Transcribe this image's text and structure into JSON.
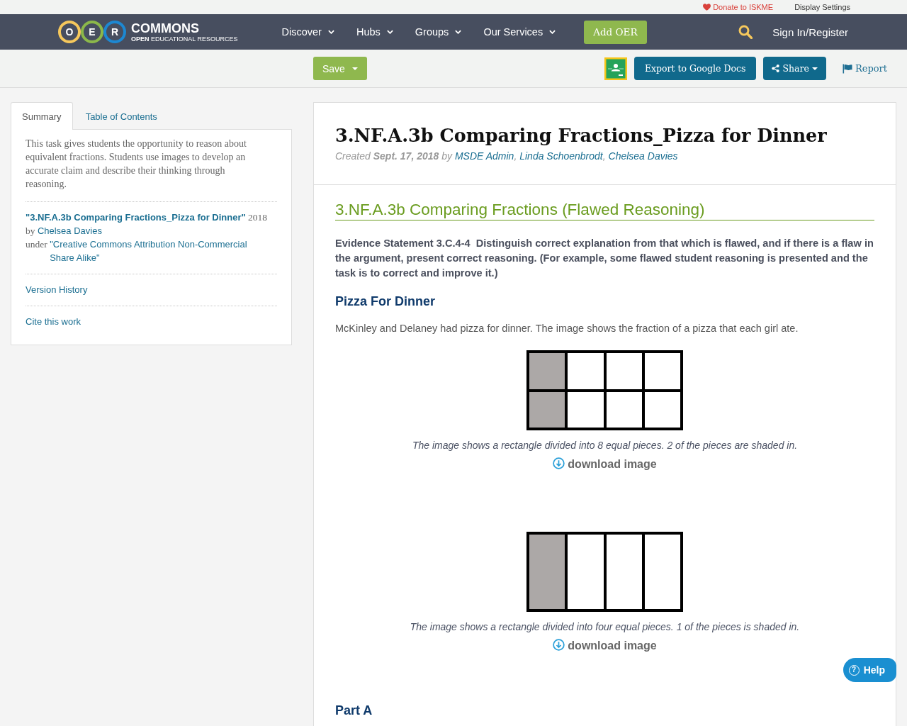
{
  "top_bar": {
    "links": [
      {
        "kind": "donate",
        "label": "Donate to ISKME"
      },
      {
        "kind": "plain",
        "label": "Display Settings"
      }
    ]
  },
  "nav": {
    "logo": {
      "rings": [
        {
          "letter": "O",
          "color": "#f6c85c"
        },
        {
          "letter": "E",
          "color": "#8cb84a"
        },
        {
          "letter": "R",
          "color": "#1d88d2"
        }
      ],
      "wordmark": "COMMONS",
      "tagline": "**OPEN** EDUCATIONAL RESOURCES"
    },
    "menu": [
      {
        "label": "Discover"
      },
      {
        "label": "Hubs"
      },
      {
        "label": "Groups"
      },
      {
        "label": "Our Services"
      }
    ],
    "add_button": "Add OER",
    "sign_in": "Sign In/Register"
  },
  "toolbar": {
    "save": "Save",
    "export": "Export to Google Docs",
    "share": "Share",
    "report": "Report"
  },
  "sidebar": {
    "tabs": [
      {
        "label": "Summary",
        "selected": true
      },
      {
        "label": "Table of Contents",
        "selected": false
      }
    ],
    "description": "This task gives students the opportunity to reason about equivalent fractions. Students use images to develop an accurate claim and describe their thinking through reasoning.",
    "attribution": {
      "title": "\"3.NF.A.3b Comparing Fractions_Pizza for Dinner\"",
      "year": "2018",
      "by": "by",
      "author": "Chelsea Davies",
      "under": "under",
      "license": "\"Creative Commons Attribution Non-Commercial Share Alike\""
    },
    "links": [
      "Version History",
      "Cite this work"
    ]
  },
  "resource": {
    "title": "3.NF.A.3b Comparing Fractions_Pizza for Dinner",
    "byline": [
      {
        "kind": "text",
        "text": "Created"
      },
      {
        "kind": "date",
        "text": "Sept. 17, 2018"
      },
      {
        "kind": "text",
        "text": "by"
      },
      {
        "kind": "link",
        "text": "MSDE Admin"
      },
      {
        "kind": "comma",
        "text": ","
      },
      {
        "kind": "link",
        "text": "Linda Schoenbrodt"
      },
      {
        "kind": "comma",
        "text": ","
      },
      {
        "kind": "link",
        "text": "Chelsea Davies"
      }
    ],
    "section_title": "3.NF.A.3b Comparing Fractions (Flawed Reasoning)",
    "evidence": "Evidence Statement 3.C.4-4  Distinguish correct explanation from that which is flawed, and if there is a flaw in the argument, present correct reasoning. (For example, some flawed student reasoning is presented and the task is to correct and improve it.)",
    "heading": "Pizza For Dinner",
    "intro": "McKinley and Delaney had pizza for dinner. The image shows the fraction of a pizza that each girl ate.",
    "figures": [
      {
        "rows": [
          {
            "cells": [
              {
                "shaded": true
              },
              {
                "shaded": false
              },
              {
                "shaded": false
              },
              {
                "shaded": false
              }
            ]
          },
          {
            "cells": [
              {
                "shaded": true
              },
              {
                "shaded": false
              },
              {
                "shaded": false
              },
              {
                "shaded": false
              }
            ]
          }
        ],
        "caption": "The image shows a rectangle divided into 8 equal pieces. 2 of the pieces are shaded in.",
        "download": "download image"
      },
      {
        "rows": [
          {
            "cells": [
              {
                "shaded": true
              },
              {
                "shaded": false
              },
              {
                "shaded": false
              },
              {
                "shaded": false
              }
            ]
          }
        ],
        "caption": "The image shows a rectangle divided into four equal pieces. 1 of the pieces is shaded in.",
        "download": "download image"
      }
    ],
    "part_heading": "Part A"
  },
  "help": {
    "icon": "?",
    "label": "Help"
  }
}
